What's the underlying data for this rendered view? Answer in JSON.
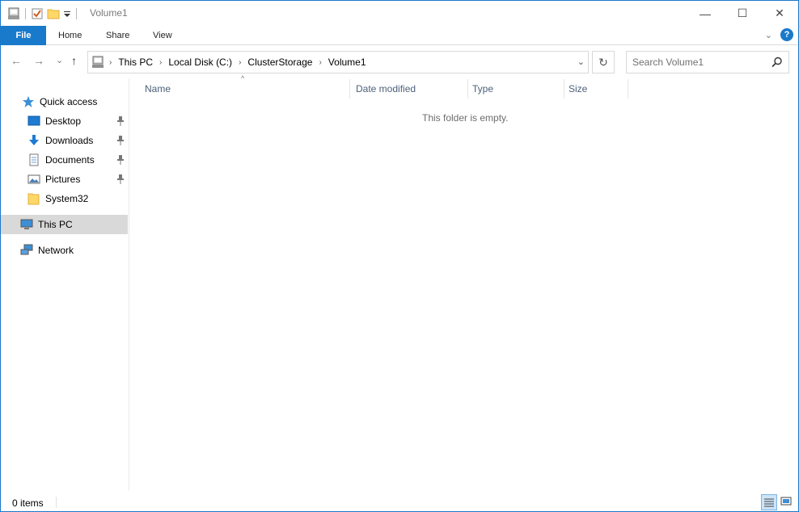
{
  "window": {
    "title": "Volume1",
    "controls": {
      "minimize": "—",
      "maximize": "☐",
      "close": "✕"
    }
  },
  "ribbon": {
    "tabs": [
      {
        "label": "File"
      },
      {
        "label": "Home"
      },
      {
        "label": "Share"
      },
      {
        "label": "View"
      }
    ],
    "help_label": "?"
  },
  "nav": {
    "back": "←",
    "forward": "→",
    "recent": "⌄",
    "up": "↑"
  },
  "address": {
    "crumbs": [
      "This PC",
      "Local Disk (C:)",
      "ClusterStorage",
      "Volume1"
    ],
    "separator": "›",
    "dropdown": "⌄",
    "refresh": "↻"
  },
  "search": {
    "placeholder": "Search Volume1"
  },
  "sidebar": {
    "items": [
      {
        "label": "Quick access",
        "icon": "star-icon"
      },
      {
        "label": "Desktop",
        "icon": "desktop-icon",
        "pinned": true
      },
      {
        "label": "Downloads",
        "icon": "download-icon",
        "pinned": true
      },
      {
        "label": "Documents",
        "icon": "document-icon",
        "pinned": true
      },
      {
        "label": "Pictures",
        "icon": "pictures-icon",
        "pinned": true
      },
      {
        "label": "System32",
        "icon": "folder-icon",
        "pinned": false
      },
      {
        "label": "This PC",
        "icon": "computer-icon",
        "selected": true
      },
      {
        "label": "Network",
        "icon": "network-icon"
      }
    ]
  },
  "content": {
    "columns": [
      "Name",
      "Date modified",
      "Type",
      "Size"
    ],
    "sort_indicator": "^",
    "empty_message": "This folder is empty."
  },
  "status": {
    "item_count": "0 items"
  },
  "colors": {
    "accent": "#1979ca",
    "selected_bg": "#d9d9d9",
    "header_text": "#4c607a"
  }
}
